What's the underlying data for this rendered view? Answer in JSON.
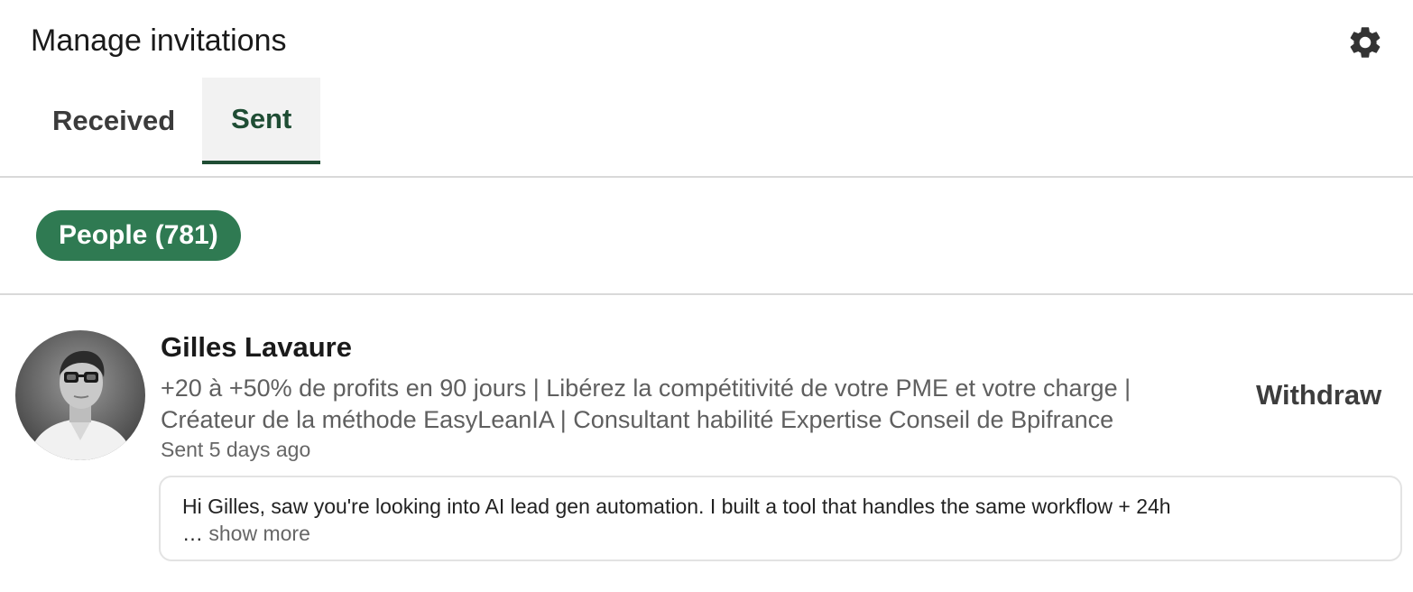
{
  "header": {
    "title": "Manage invitations",
    "settings_icon": "gear-icon"
  },
  "tabs": [
    {
      "label": "Received",
      "active": false
    },
    {
      "label": "Sent",
      "active": true
    }
  ],
  "filter": {
    "label": "People (781)"
  },
  "invitation": {
    "name": "Gilles Lavaure",
    "headline_line1": "+20 à +50% de profits en 90 jours | Libérez la compétitivité de votre PME et votre charge |",
    "headline_line2": "Créateur de la méthode EasyLeanIA | Consultant habilité Expertise Conseil de Bpifrance",
    "sent_time": "Sent 5 days ago",
    "withdraw_label": "Withdraw",
    "message": "Hi Gilles, saw you're looking into AI lead gen automation. I built a tool that handles the same workflow + 24h",
    "ellipsis": "…",
    "show_more_label": "show more"
  },
  "colors": {
    "accent": "#1f4d34",
    "pill": "#2f7a52",
    "divider": "#d9d9d9"
  }
}
